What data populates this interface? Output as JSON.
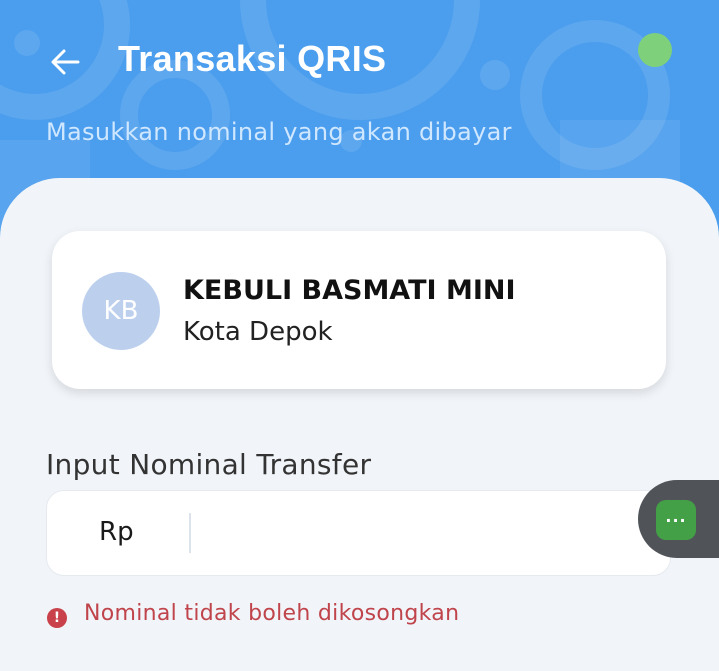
{
  "header": {
    "title": "Transaksi QRIS",
    "subtitle": "Masukkan nominal yang akan dibayar",
    "back_icon": "arrow-left-icon",
    "status_color": "#7ed17a",
    "background_color": "#4b9ded"
  },
  "merchant": {
    "initials": "KB",
    "name": "KEBULI BASMATI MINI",
    "city": "Kota Depok"
  },
  "form": {
    "label": "Input Nominal Transfer",
    "currency": "Rp",
    "value": "",
    "error_icon": "!",
    "error": "Nominal tidak boleh dikosongkan"
  },
  "chat": {
    "icon": "chat-dots-icon",
    "glyph": "···"
  }
}
